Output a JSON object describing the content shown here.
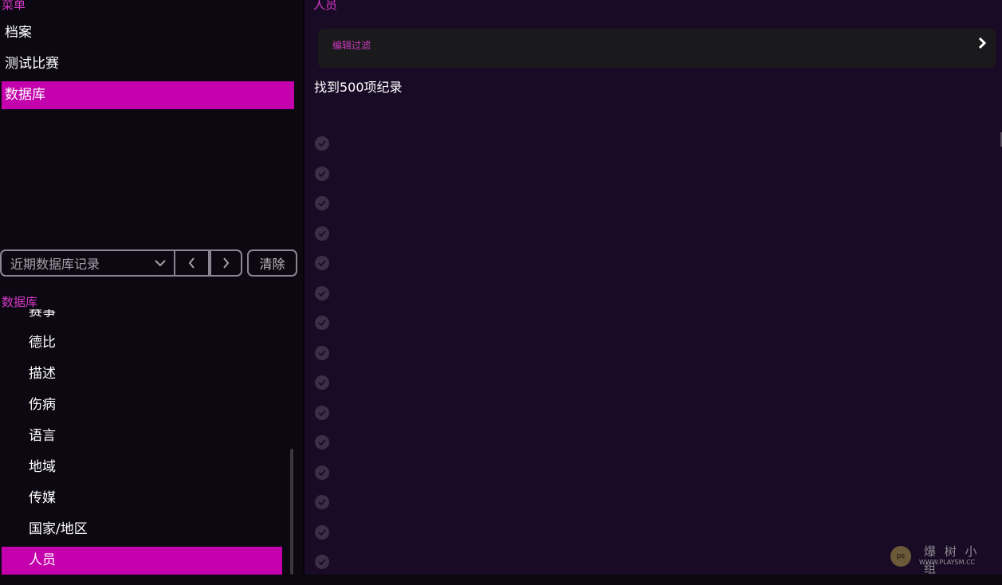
{
  "sidebar": {
    "menu_title": "菜单",
    "menu_items": [
      {
        "label": "档案",
        "active": false
      },
      {
        "label": "测试比赛",
        "active": false
      },
      {
        "label": "数据库",
        "active": true
      }
    ],
    "history": {
      "select_value": "近期数据库记录",
      "prev_icon": "chevron-left-icon",
      "next_icon": "chevron-right-icon",
      "clear_label": "清除"
    },
    "db_title": "数据库",
    "db_items": [
      {
        "label": "赛事",
        "active": false
      },
      {
        "label": "德比",
        "active": false
      },
      {
        "label": "描述",
        "active": false
      },
      {
        "label": "伤病",
        "active": false
      },
      {
        "label": "语言",
        "active": false
      },
      {
        "label": "地域",
        "active": false
      },
      {
        "label": "传媒",
        "active": false
      },
      {
        "label": "国家/地区",
        "active": false
      },
      {
        "label": "人员",
        "active": true
      }
    ]
  },
  "main": {
    "title": "人员",
    "filter_label": "编辑过滤",
    "filter_icon": "chevron-right-icon",
    "result_count": "找到500项纪录",
    "check_rows": 15,
    "check_icon": "check-circle-icon"
  },
  "watermark": {
    "logo_text": "ps",
    "text_cn": "爆 树 小 组",
    "text_en": "WWW.PLAYSM.CC"
  },
  "colors": {
    "accent": "#c300ab",
    "title_pink": "#d63ac9",
    "main_bg": "#190b25",
    "sidebar_bg": "#0c0812"
  }
}
